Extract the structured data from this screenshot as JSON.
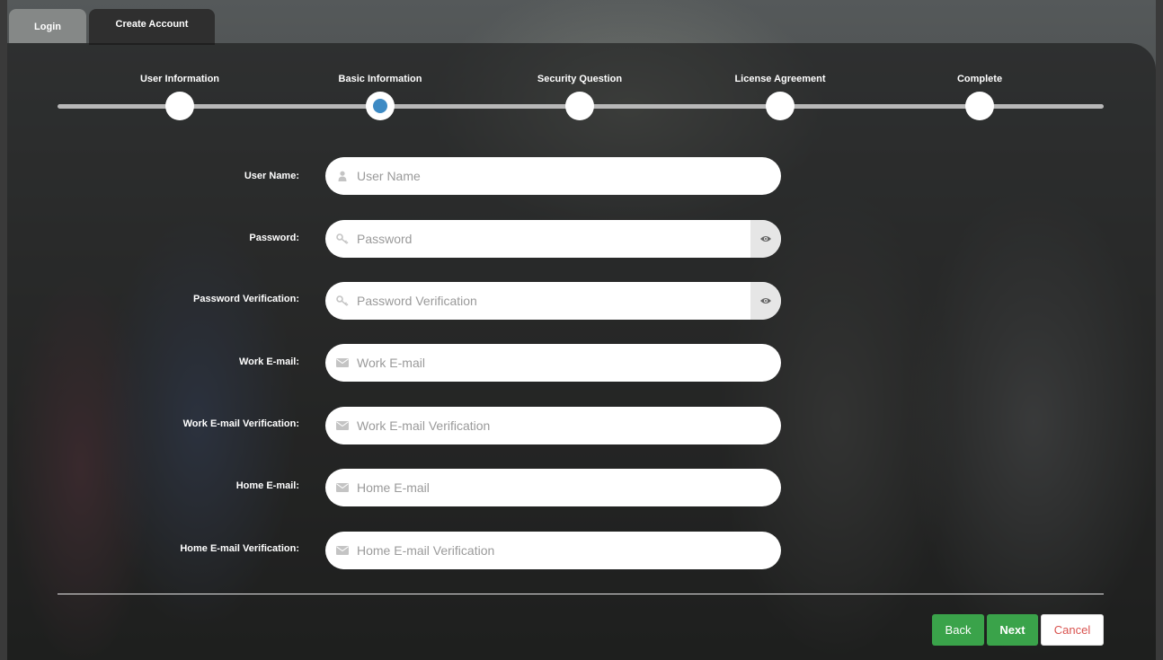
{
  "tabs": {
    "login": "Login",
    "create_account": "Create Account"
  },
  "steps": [
    {
      "label": "User Information",
      "active": false
    },
    {
      "label": "Basic Information",
      "active": true
    },
    {
      "label": "Security Question",
      "active": false
    },
    {
      "label": "License Agreement",
      "active": false
    },
    {
      "label": "Complete",
      "active": false
    }
  ],
  "form": {
    "user_name": {
      "label": "User Name:",
      "placeholder": "User Name",
      "icon": "user-icon"
    },
    "password": {
      "label": "Password:",
      "placeholder": "Password",
      "icon": "key-icon",
      "toggle_icon": "eye-icon"
    },
    "password_verification": {
      "label": "Password Verification:",
      "placeholder": "Password Verification",
      "icon": "key-icon",
      "toggle_icon": "eye-icon"
    },
    "work_email": {
      "label": "Work E-mail:",
      "placeholder": "Work E-mail",
      "icon": "envelope-icon"
    },
    "work_email_verification": {
      "label": "Work E-mail Verification:",
      "placeholder": "Work E-mail Verification",
      "icon": "envelope-icon"
    },
    "home_email": {
      "label": "Home E-mail:",
      "placeholder": "Home E-mail",
      "icon": "envelope-icon"
    },
    "home_email_verification": {
      "label": "Home E-mail Verification:",
      "placeholder": "Home E-mail Verification",
      "icon": "envelope-icon"
    }
  },
  "buttons": {
    "back": "Back",
    "next": "Next",
    "cancel": "Cancel"
  },
  "colors": {
    "accent_green": "#3aa34a",
    "active_step_blue": "#3d8ac4",
    "cancel_red": "#d9534f"
  }
}
